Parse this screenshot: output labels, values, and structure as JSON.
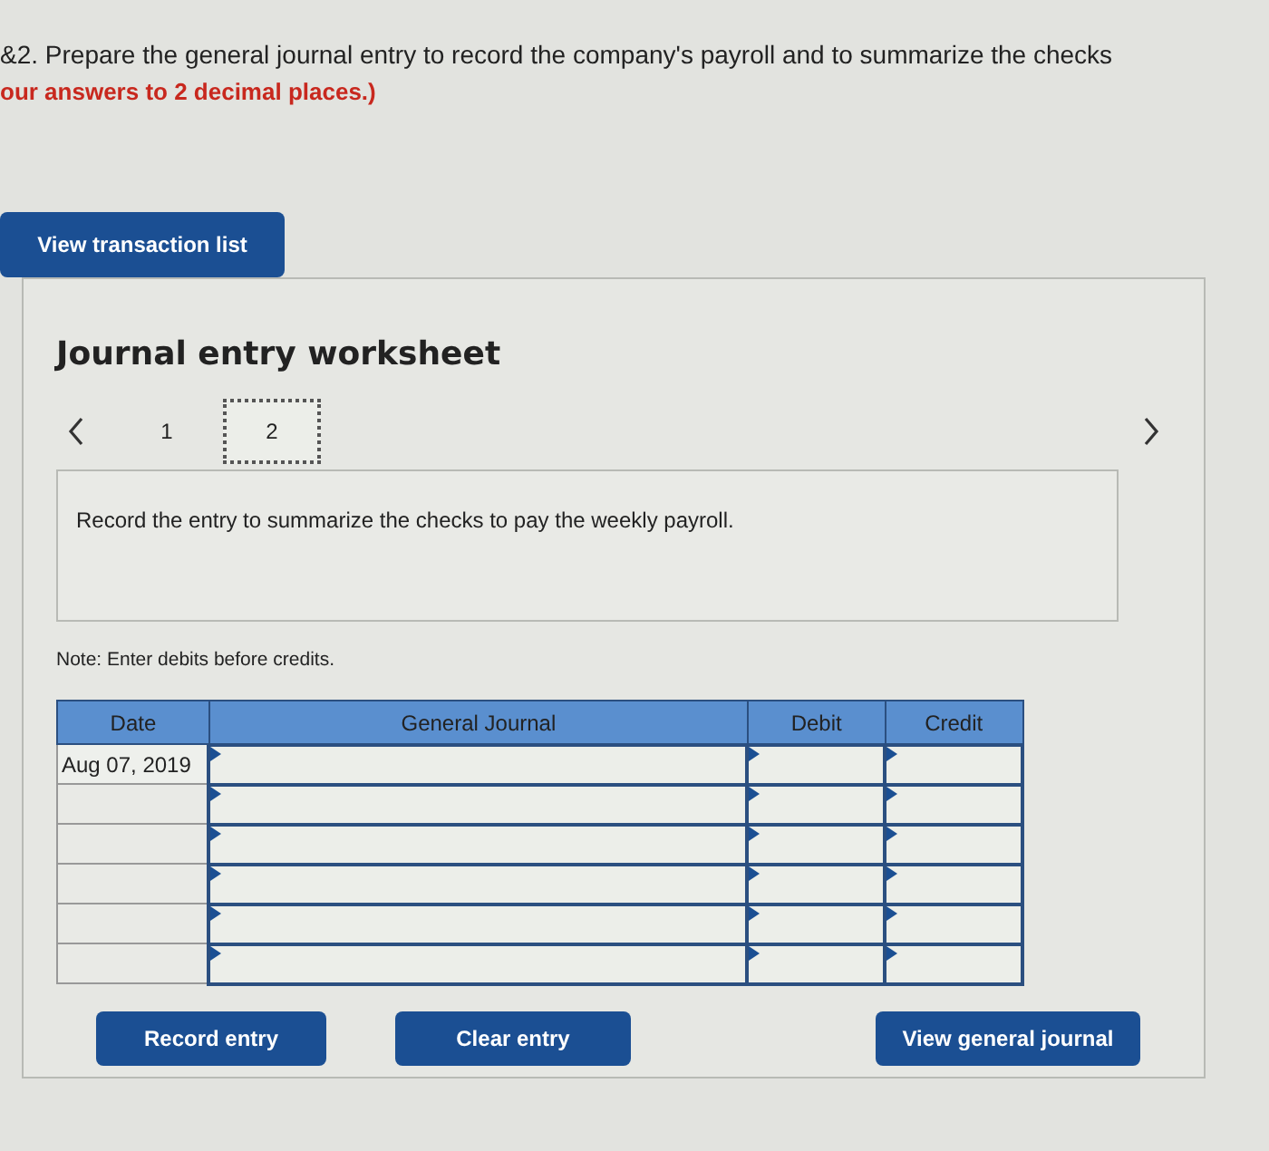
{
  "question": {
    "text": "&2. Prepare the general journal entry to record the company's payroll and to summarize the checks",
    "instruction": "our answers to 2 decimal places.)"
  },
  "top_button": "View transaction list",
  "worksheet": {
    "title": "Journal entry worksheet",
    "pages": [
      {
        "label": "1",
        "selected": false
      },
      {
        "label": "2",
        "selected": true
      }
    ],
    "prompt": "Record the entry to summarize the checks to pay the weekly payroll.",
    "note": "Note: Enter debits before credits.",
    "table": {
      "columns": [
        "Date",
        "General Journal",
        "Debit",
        "Credit"
      ],
      "rows": [
        {
          "kind": "dated",
          "date": "Aug 07, 2019"
        },
        {
          "kind": "blank"
        },
        {
          "kind": "blank"
        },
        {
          "kind": "blank"
        },
        {
          "kind": "blank"
        },
        {
          "kind": "blank"
        }
      ]
    },
    "buttons": [
      "Record entry",
      "Clear entry",
      "View general journal"
    ]
  }
}
